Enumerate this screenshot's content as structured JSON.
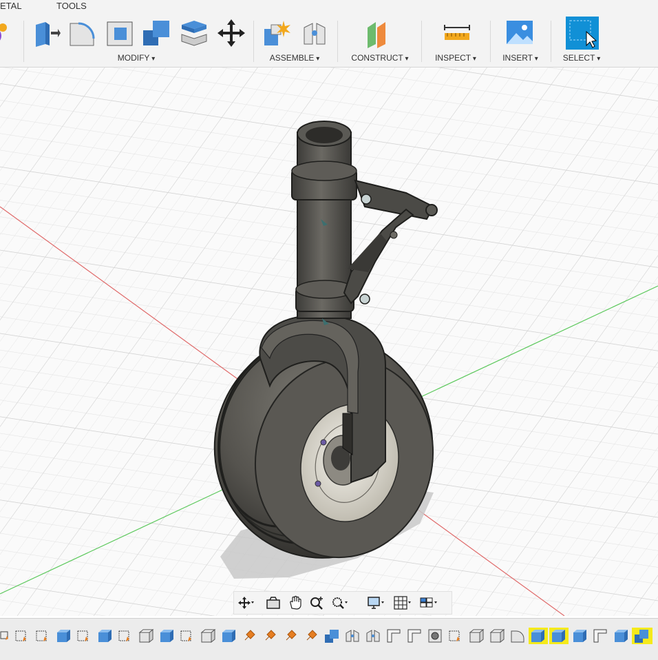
{
  "toolbar": {
    "tabs": {
      "sheet_metal": "ETAL",
      "tools": "TOOLS"
    },
    "groups": {
      "modify": "MODIFY",
      "assemble": "ASSEMBLE",
      "construct": "CONSTRUCT",
      "inspect": "INSPECT",
      "insert": "INSERT",
      "select": "SELECT"
    },
    "icons": {
      "create_form": "create-form-icon",
      "press_pull": "press-pull-icon",
      "fillet": "fillet-icon",
      "shell": "shell-icon",
      "combine": "combine-icon",
      "offset_face": "offset-face-icon",
      "move": "move-icon",
      "new_component": "new-component-icon",
      "joint": "joint-icon",
      "offset_plane": "offset-plane-icon",
      "measure": "measure-icon",
      "insert_image": "insert-image-icon",
      "select": "select-icon"
    }
  },
  "viewport": {
    "model": "nose landing gear assembly",
    "axis_colors": {
      "x": "#e06a6a",
      "y": "#5ac85a"
    }
  },
  "navbar": {
    "items": [
      "orbit-icon",
      "look-at-icon",
      "pan-icon",
      "zoom-icon",
      "fit-icon",
      "display-settings-icon",
      "grid-settings-icon",
      "viewports-icon"
    ]
  },
  "timeline": {
    "highlight_color": "#f5ea1a"
  }
}
